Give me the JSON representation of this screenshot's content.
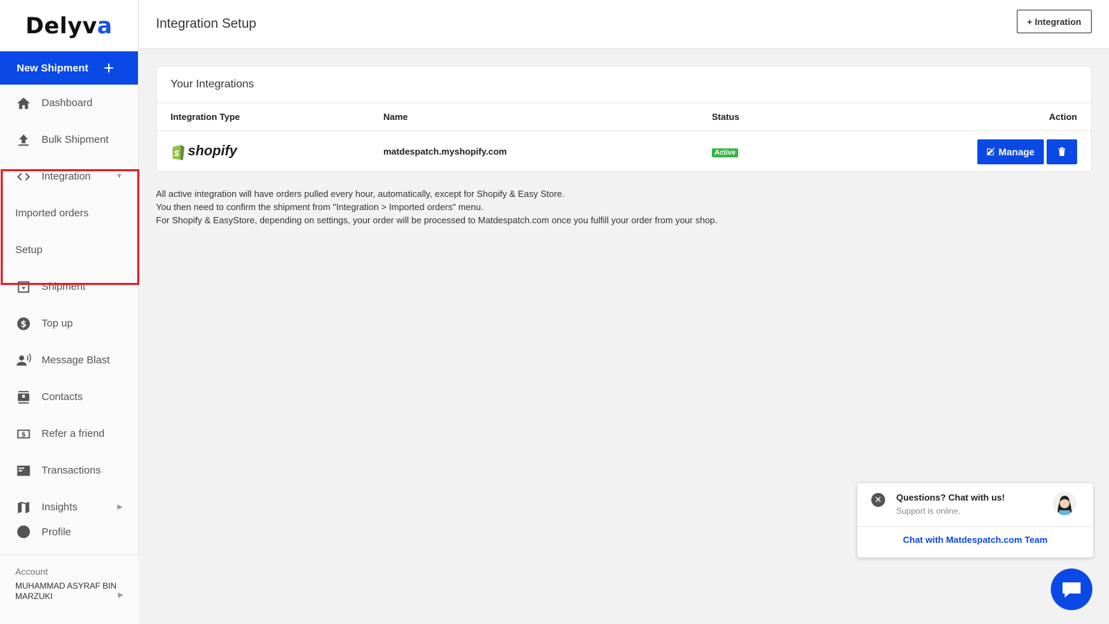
{
  "brand": {
    "logo_text_a": "Delyv",
    "logo_text_b": "a"
  },
  "sidebar": {
    "new_shipment_label": "New Shipment",
    "items": [
      {
        "label": "Dashboard",
        "icon": "home-icon"
      },
      {
        "label": "Bulk Shipment",
        "icon": "upload-icon"
      },
      {
        "label": "Integration",
        "icon": "code-icon"
      },
      {
        "label": "Shipment",
        "icon": "box-icon"
      },
      {
        "label": "Top up",
        "icon": "dollar-icon"
      },
      {
        "label": "Message Blast",
        "icon": "broadcast-icon"
      },
      {
        "label": "Contacts",
        "icon": "contacts-icon"
      },
      {
        "label": "Refer a friend",
        "icon": "refer-icon"
      },
      {
        "label": "Transactions",
        "icon": "card-icon"
      },
      {
        "label": "Insights",
        "icon": "map-icon"
      },
      {
        "label": "Profile",
        "icon": "user-icon"
      }
    ],
    "integration_sub": [
      "Imported orders",
      "Setup"
    ],
    "account_label": "Account",
    "account_name": "MUHAMMAD ASYRAF BIN MARZUKI"
  },
  "header": {
    "title": "Integration Setup",
    "add_button": "+ Integration"
  },
  "integrations": {
    "title": "Your Integrations",
    "columns": [
      "Integration Type",
      "Name",
      "Status",
      "Action"
    ],
    "rows": [
      {
        "type": "shopify",
        "name": "matdespatch.myshopify.com",
        "status": "Active",
        "manage_label": "Manage"
      }
    ]
  },
  "info": [
    "All active integration will have orders pulled every hour, automatically, except for Shopify & Easy Store.",
    "You then need to confirm the shipment from \"Integration > Imported orders\" menu.",
    "For Shopify & EasyStore, depending on settings, your order will be processed to Matdespatch.com once you fulfill your order from your shop."
  ],
  "chat": {
    "question": "Questions? Chat with us!",
    "status": "Support is online.",
    "link": "Chat with Matdespatch.com Team"
  },
  "colors": {
    "primary": "#0b49e6",
    "active": "#3bb54a",
    "highlight": "#e3212b"
  }
}
